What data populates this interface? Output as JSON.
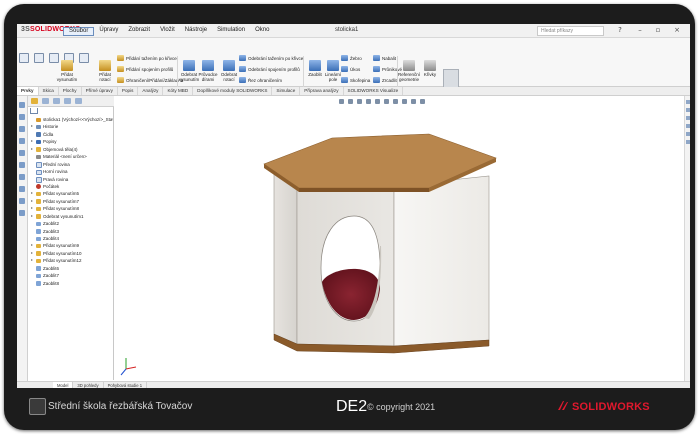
{
  "app": {
    "logo_brand": "3S",
    "logo_product": "SOLIDWORKS",
    "document_title": "stolicka1",
    "search_placeholder": "Hledat příkazy",
    "menu": [
      "Soubor",
      "Úpravy",
      "Zobrazit",
      "Vložit",
      "Nástroje",
      "Simulation",
      "Okno"
    ]
  },
  "ribbon": {
    "big_buttons": [
      {
        "label": "Přidat vysunutím",
        "icon": "extrude-boss-icon"
      },
      {
        "label": "Přidat rotací",
        "icon": "revolve-boss-icon"
      },
      {
        "label": "Odebrat vysunutím",
        "icon": "extrude-cut-icon"
      },
      {
        "label": "Průvodce dírami",
        "icon": "hole-wizard-icon"
      },
      {
        "label": "Odebrat rotací",
        "icon": "revolve-cut-icon"
      },
      {
        "label": "Zaoblit",
        "icon": "fillet-icon"
      },
      {
        "label": "Lineární pole",
        "icon": "linear-pattern-icon"
      },
      {
        "label": "Referenční geometrie",
        "icon": "reference-geometry-icon"
      },
      {
        "label": "Křivky",
        "icon": "curves-icon"
      },
      {
        "label": "Rychlé 3D",
        "icon": "instant3d-icon"
      }
    ],
    "small_buttons": [
      {
        "label": "Přidání tažením po křivce",
        "icon": "swept-boss-icon"
      },
      {
        "label": "Přidání spojením profilů",
        "icon": "lofted-boss-icon"
      },
      {
        "label": "Ohraničení/Přidání/Základna",
        "icon": "boundary-boss-icon"
      },
      {
        "label": "Odebrání tažením po křivce",
        "icon": "swept-cut-icon"
      },
      {
        "label": "Odebrání spojením profilů",
        "icon": "lofted-cut-icon"
      },
      {
        "label": "Řez ohraničením",
        "icon": "boundary-cut-icon"
      },
      {
        "label": "Žebro",
        "icon": "rib-icon"
      },
      {
        "label": "Úkos",
        "icon": "draft-icon"
      },
      {
        "label": "Skořepina",
        "icon": "shell-icon"
      },
      {
        "label": "Nabalit",
        "icon": "wrap-icon"
      },
      {
        "label": "Průnikové",
        "icon": "intersect-icon"
      },
      {
        "label": "Zrcadlit",
        "icon": "mirror-icon"
      }
    ]
  },
  "tabs": [
    {
      "label": "Prvky",
      "active": true
    },
    {
      "label": "Skica"
    },
    {
      "label": "Plochy"
    },
    {
      "label": "Přímé úpravy"
    },
    {
      "label": "Popis"
    },
    {
      "label": "Analýzy"
    },
    {
      "label": "Kóty MBD"
    },
    {
      "label": "Doplňkové moduly SOLIDWORKS"
    },
    {
      "label": "Simulace"
    },
    {
      "label": "Příprava analýzy"
    },
    {
      "label": "SOLIDWORKS Visualize"
    }
  ],
  "tree": [
    {
      "label": "stolicka1 (Výchozí<<Výchozí>_Stav",
      "icon": "part-icon",
      "indent": 0,
      "toggle": ""
    },
    {
      "label": "Historie",
      "icon": "history-icon",
      "indent": 1,
      "toggle": "▸"
    },
    {
      "label": "Čidla",
      "icon": "sensors-icon",
      "indent": 1,
      "toggle": ""
    },
    {
      "label": "Popisy",
      "icon": "annotations-icon",
      "indent": 1,
      "toggle": "▸"
    },
    {
      "label": "Objemová těla(4)",
      "icon": "solid-bodies-icon",
      "indent": 1,
      "toggle": "▸"
    },
    {
      "label": "Materiál <není určen>",
      "icon": "material-icon",
      "indent": 1,
      "toggle": ""
    },
    {
      "label": "Přední rovina",
      "icon": "plane-icon",
      "indent": 1,
      "toggle": ""
    },
    {
      "label": "Horní rovina",
      "icon": "plane-icon",
      "indent": 1,
      "toggle": ""
    },
    {
      "label": "Pravá rovina",
      "icon": "plane-icon",
      "indent": 1,
      "toggle": ""
    },
    {
      "label": "Počátek",
      "icon": "origin-icon",
      "indent": 1,
      "toggle": ""
    },
    {
      "label": "Přidat vysunutím5",
      "icon": "extrude-icon",
      "indent": 1,
      "toggle": "▸"
    },
    {
      "label": "Přidat vysunutím7",
      "icon": "extrude-icon",
      "indent": 1,
      "toggle": "▸"
    },
    {
      "label": "Přidat vysunutím8",
      "icon": "extrude-icon",
      "indent": 1,
      "toggle": "▸"
    },
    {
      "label": "Odebrat vysunutím1",
      "icon": "cut-icon",
      "indent": 1,
      "toggle": "▸"
    },
    {
      "label": "Zaoblit2",
      "icon": "fillet-icon",
      "indent": 1,
      "toggle": ""
    },
    {
      "label": "Zaoblit3",
      "icon": "fillet-icon",
      "indent": 1,
      "toggle": ""
    },
    {
      "label": "Zaoblit4",
      "icon": "fillet-icon",
      "indent": 1,
      "toggle": ""
    },
    {
      "label": "Přidat vysunutím9",
      "icon": "extrude-icon",
      "indent": 1,
      "toggle": "▸"
    },
    {
      "label": "Přidat vysunutím10",
      "icon": "extrude-icon",
      "indent": 1,
      "toggle": "▸"
    },
    {
      "label": "Přidat vysunutím12",
      "icon": "extrude-icon",
      "indent": 1,
      "toggle": "▸"
    },
    {
      "label": "Zaoblit6",
      "icon": "fillet-icon",
      "indent": 1,
      "toggle": ""
    },
    {
      "label": "Zaoblit7",
      "icon": "fillet-icon",
      "indent": 1,
      "toggle": ""
    },
    {
      "label": "Zaoblit8",
      "icon": "fillet-icon",
      "indent": 1,
      "toggle": ""
    }
  ],
  "bottom_tabs": [
    {
      "label": "Model",
      "active": true
    },
    {
      "label": "3D pohledy"
    },
    {
      "label": "Pohybová studie 1"
    }
  ],
  "footer": {
    "school": "Střední škola řezbářská Tovačov",
    "code": "DE2",
    "copyright": "© copyright 2021",
    "brand": "SOLIDWORKS"
  },
  "colors": {
    "solidworks_red": "#d6001c",
    "wood_top": "#b8864d",
    "panel_side": "#f3f1ee",
    "cushion": "#7a1a26"
  }
}
